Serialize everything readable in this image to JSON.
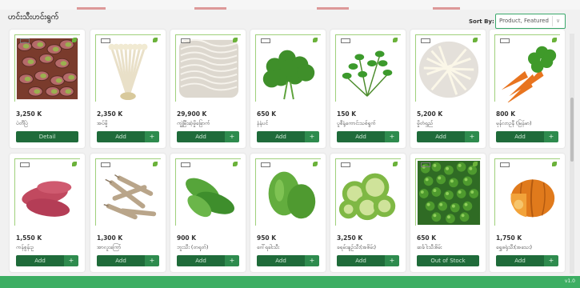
{
  "header": {
    "title": "ဟင်းသီးဟင်းရွက်"
  },
  "sort": {
    "label": "Sort By:",
    "selected": "Product, Featured"
  },
  "accent": "#3dae63",
  "button_color": "#1f6b3a",
  "products": [
    {
      "price": "3,250 K",
      "name": "ပဲတီပြဲ",
      "button": "Detail",
      "icon": "pistachio"
    },
    {
      "price": "2,350 K",
      "name": "အပ်မှို",
      "button": "Add",
      "icon": "enoki"
    },
    {
      "price": "29,900 K",
      "name": "ကျွဲမြီးဆံ့မှိုခြောက်",
      "button": "Add",
      "icon": "dried-noodle"
    },
    {
      "price": "650 K",
      "name": "နံနံပင်",
      "button": "Add",
      "icon": "parsley"
    },
    {
      "price": "150 K",
      "name": "ပူစီနံ့ကောင်းသစ်ရွက်",
      "button": "Add",
      "icon": "mint"
    },
    {
      "price": "5,200 K",
      "name": "မှိုတံရှည်",
      "button": "Add",
      "icon": "bean-sprouts"
    },
    {
      "price": "800 K",
      "name": "မုန်လာဥနီ (မြန်မာ)",
      "button": "Add",
      "icon": "carrot"
    },
    {
      "price": "1,550 K",
      "name": "ကန်စွန်းဥ",
      "button": "Add",
      "icon": "sweet-potato"
    },
    {
      "price": "1,300 K",
      "name": "အာလူးကြော်",
      "button": "Add",
      "icon": "ginseng"
    },
    {
      "price": "900 K",
      "name": "ဘူးသီး (တရုတ်)",
      "button": "Add",
      "icon": "bottle-gourd"
    },
    {
      "price": "950 K",
      "name": "ဂေါ်ရခါးသီး",
      "button": "Add",
      "icon": "chayote"
    },
    {
      "price": "3,250 K",
      "name": "ခရမ်းချဉ်သီး(အစိမ်း)",
      "button": "Add",
      "icon": "green-gourd"
    },
    {
      "price": "650 K",
      "name": "ဆင်္ခါးသီးစိမ်း",
      "button": "Out of Stock",
      "icon": "pea-eggplant"
    },
    {
      "price": "1,750 K",
      "name": "ရွှေဖရုံသီး(အသေး)",
      "button": "Add",
      "icon": "pumpkin"
    }
  ],
  "footer": {
    "version": "v1.0"
  }
}
